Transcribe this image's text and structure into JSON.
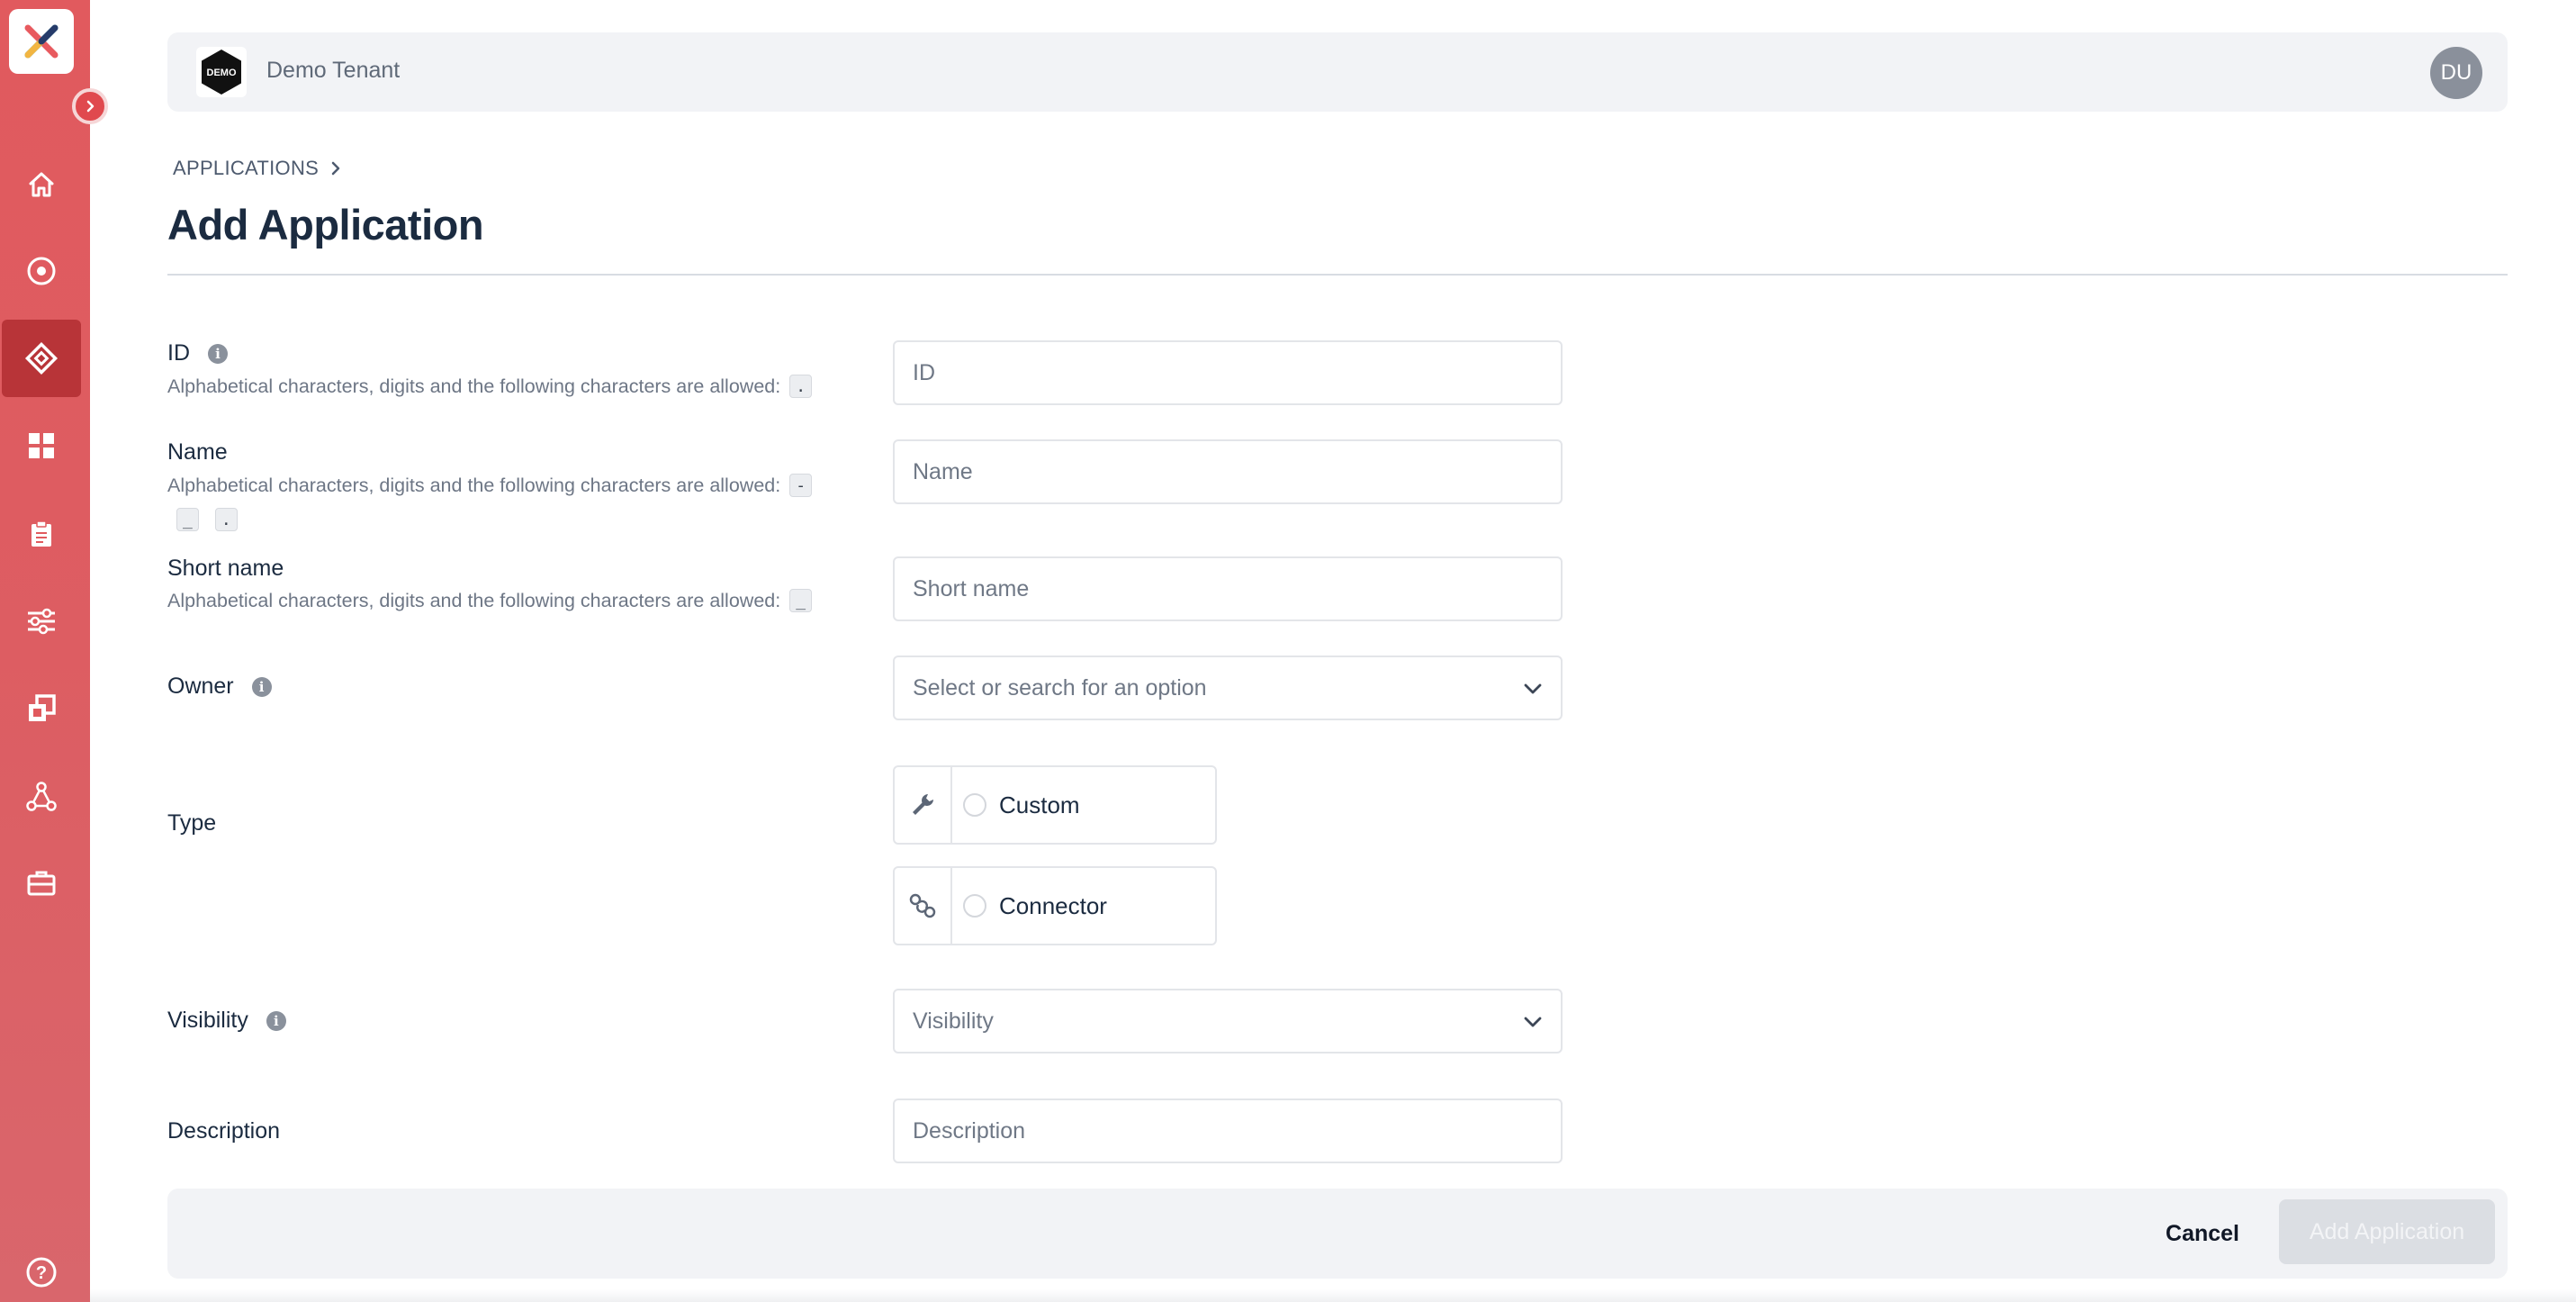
{
  "header": {
    "tenant_logo_text": "DEMO",
    "tenant_name": "Demo Tenant",
    "avatar_initials": "DU"
  },
  "sidebar": {
    "items": [
      {
        "name": "home-icon",
        "active": false
      },
      {
        "name": "target-icon",
        "active": false
      },
      {
        "name": "applications-icon",
        "active": true
      },
      {
        "name": "dashboard-icon",
        "active": false
      },
      {
        "name": "clipboard-icon",
        "active": false
      },
      {
        "name": "sliders-icon",
        "active": false
      },
      {
        "name": "copy-icon",
        "active": false
      },
      {
        "name": "network-icon",
        "active": false
      },
      {
        "name": "toolbox-icon",
        "active": false
      }
    ],
    "help_icon": "help-circle-icon",
    "accent": "#e15a5e"
  },
  "breadcrumb": {
    "item": "APPLICATIONS"
  },
  "page": {
    "title": "Add Application"
  },
  "form": {
    "allowed_text": "Alphabetical characters, digits and the following characters are allowed:",
    "id": {
      "label": "ID",
      "chars": [
        "."
      ],
      "placeholder": "ID",
      "value": ""
    },
    "name": {
      "label": "Name",
      "chars": [
        "-",
        "_",
        "."
      ],
      "placeholder": "Name",
      "value": ""
    },
    "short_name": {
      "label": "Short name",
      "chars": [
        "_"
      ],
      "placeholder": "Short name",
      "value": ""
    },
    "owner": {
      "label": "Owner",
      "placeholder": "Select or search for an option"
    },
    "type": {
      "label": "Type",
      "options": [
        {
          "label": "Custom",
          "icon": "wrench-icon",
          "selected": false
        },
        {
          "label": "Connector",
          "icon": "link-icon",
          "selected": false
        }
      ]
    },
    "visibility": {
      "label": "Visibility",
      "placeholder": "Visibility"
    },
    "description": {
      "label": "Description",
      "placeholder": "Description",
      "value": ""
    }
  },
  "footer": {
    "cancel_label": "Cancel",
    "submit_label": "Add Application"
  }
}
